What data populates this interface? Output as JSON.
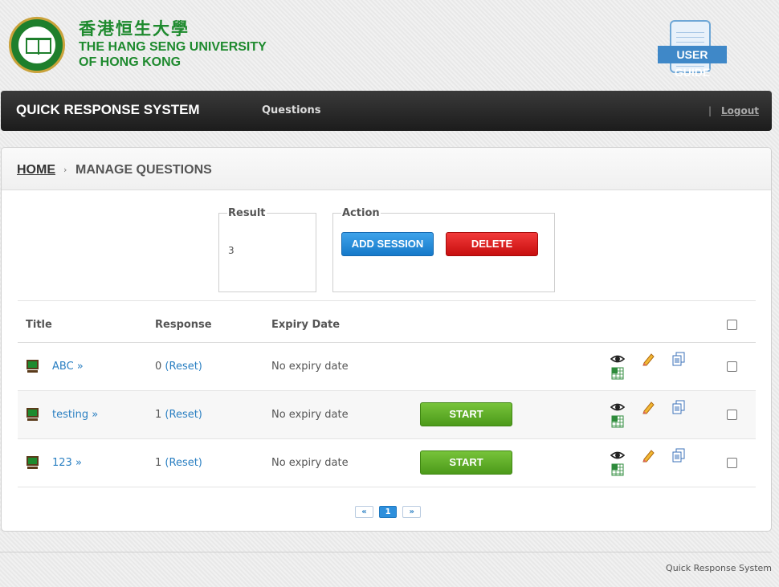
{
  "header": {
    "logo_zh": "香港恒生大學",
    "logo_en_line1": "THE HANG SENG UNIVERSITY",
    "logo_en_line2": "OF HONG KONG",
    "user_guide_label": "USER GUIDE"
  },
  "navbar": {
    "brand": "QUICK RESPONSE SYSTEM",
    "nav_questions": "Questions",
    "separator": "|",
    "logout": "Logout"
  },
  "breadcrumb": {
    "home": "HOME",
    "separator": "›",
    "current": "MANAGE QUESTIONS"
  },
  "result": {
    "legend": "Result",
    "value": "3"
  },
  "action": {
    "legend": "Action",
    "add_session": "ADD SESSION",
    "delete": "DELETE"
  },
  "table": {
    "headers": {
      "title": "Title",
      "response": "Response",
      "expiry": "Expiry Date"
    },
    "rows": [
      {
        "title": "ABC »",
        "response_count": "0",
        "reset": "(Reset)",
        "expiry": "No expiry date",
        "start": ""
      },
      {
        "title": "testing »",
        "response_count": "1",
        "reset": "(Reset)",
        "expiry": "No expiry date",
        "start": "START"
      },
      {
        "title": "123 »",
        "response_count": "1",
        "reset": "(Reset)",
        "expiry": "No expiry date",
        "start": "START"
      }
    ]
  },
  "pagination": {
    "prev": "«",
    "current": "1",
    "next": "»"
  },
  "footer": {
    "text": "Quick Response System"
  },
  "colors": {
    "brand_green": "#1e8a2e",
    "link_blue": "#2a7fc2",
    "add_blue": "#1579c9",
    "delete_red": "#c70e0e",
    "start_green": "#4c9a1a"
  },
  "icons": [
    "view-eye-icon",
    "edit-pencil-icon",
    "copy-icon",
    "export-excel-icon",
    "screen-icon"
  ]
}
